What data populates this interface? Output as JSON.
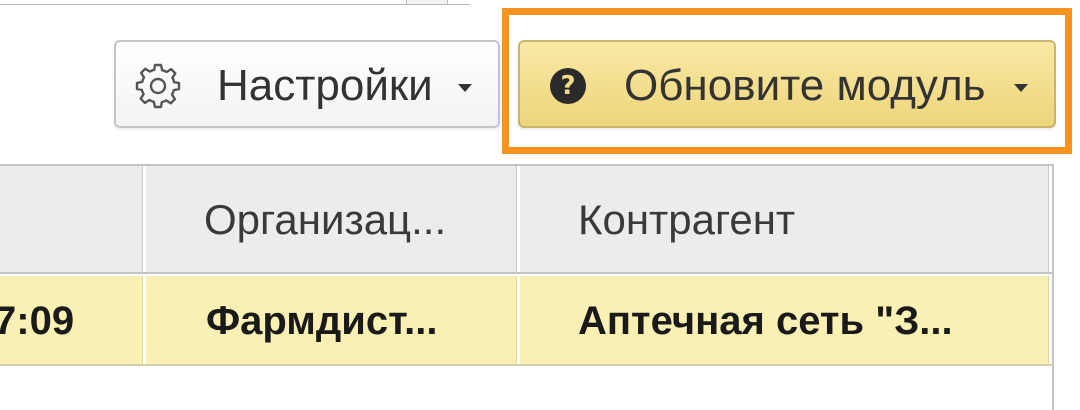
{
  "toolbar": {
    "settings_label": "Настройки",
    "settings_icon": "gear-icon",
    "update_label": "Обновите модуль",
    "update_icon": "question-circle-icon",
    "highlight_color": "#f7931e",
    "update_button_color": "#f2dc8a"
  },
  "table": {
    "columns": [
      "",
      "Организац...",
      "Контрагент"
    ],
    "rows": [
      [
        "7:09",
        "Фармдист...",
        "Аптечная сеть \"З..."
      ]
    ],
    "selected_row_color": "#fbf0b4"
  }
}
